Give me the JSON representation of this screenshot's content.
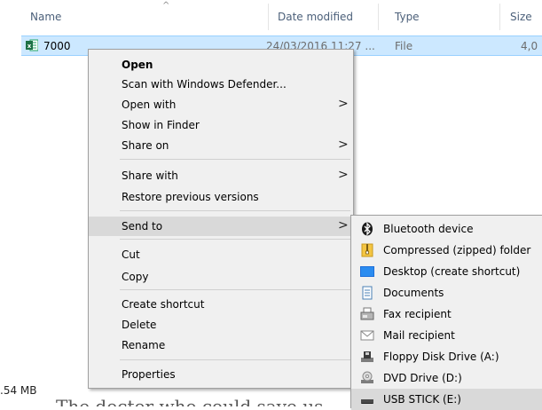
{
  "columns": {
    "name": "Name",
    "date_modified": "Date modified",
    "type": "Type",
    "size": "Size"
  },
  "file": {
    "name": "7000",
    "date": "24/03/2016 11:27 ...",
    "type": "File",
    "size": "4,0"
  },
  "status": {
    "size_text": ".54 MB",
    "background_text": "The doctor who could save us"
  },
  "context_menu": {
    "open": "Open",
    "scan": "Scan with Windows Defender...",
    "open_with": "Open with",
    "show_in_finder": "Show in Finder",
    "share_on": "Share on",
    "share_with": "Share with",
    "restore": "Restore previous versions",
    "send_to": "Send to",
    "cut": "Cut",
    "copy": "Copy",
    "create_shortcut": "Create shortcut",
    "delete": "Delete",
    "rename": "Rename",
    "properties": "Properties",
    "arrow": ">"
  },
  "send_to_menu": {
    "bluetooth": "Bluetooth device",
    "compressed": "Compressed (zipped) folder",
    "desktop": "Desktop (create shortcut)",
    "documents": "Documents",
    "fax": "Fax recipient",
    "mail": "Mail recipient",
    "floppy": "Floppy Disk Drive (A:)",
    "dvd": "DVD Drive (D:)",
    "usb": "USB STICK (E:)"
  },
  "colors": {
    "selection": "#cce8ff",
    "menu_bg": "#f0f0f0",
    "highlight": "#d9d9d9",
    "header_text": "#4c607a"
  }
}
